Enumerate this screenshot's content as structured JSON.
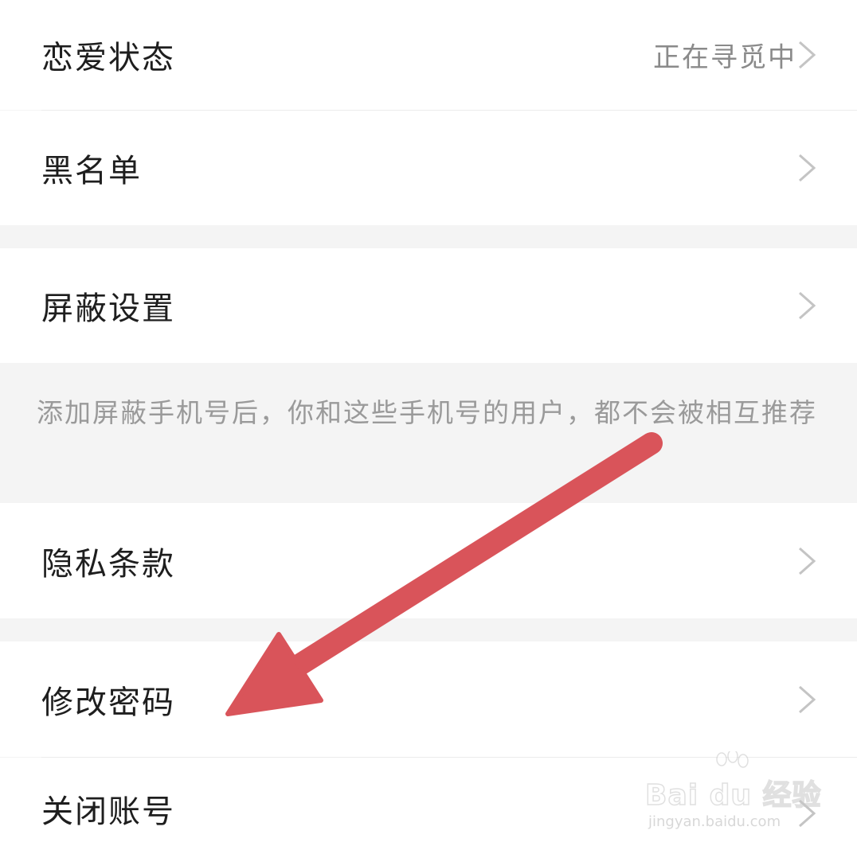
{
  "settings": {
    "rows": [
      {
        "label": "恋爱状态",
        "value": "正在寻觅中"
      },
      {
        "label": "黑名单"
      },
      {
        "label": "屏蔽设置"
      },
      {
        "label": "隐私条款"
      },
      {
        "label": "修改密码"
      },
      {
        "label": "关闭账号"
      }
    ],
    "block_hint": "添加屏蔽手机号后，你和这些手机号的用户，都不会被相互推荐"
  },
  "icons": {
    "row_chevron": "chevron-right-icon",
    "annotation": "arrow-icon"
  },
  "watermark": {
    "brand": "Bai du 经验",
    "url": "jingyan.baidu.com"
  },
  "colors": {
    "background": "#f4f4f4",
    "row_background": "#ffffff",
    "label_text": "#1e1e1e",
    "value_text": "#8a8a8a",
    "hint_text": "#9a9a9a",
    "annotation_arrow": "#d9545a"
  }
}
